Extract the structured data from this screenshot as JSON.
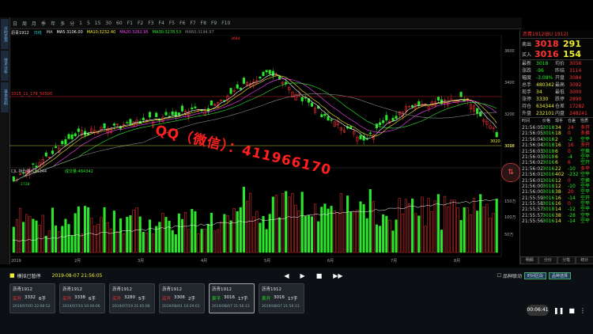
{
  "window": {
    "menu": [
      "日",
      "周",
      "月",
      "季",
      "年",
      "多",
      "分",
      "1",
      "5",
      "15",
      "30",
      "60",
      "F1",
      "F2",
      "F3",
      "F4",
      "F5",
      "F6",
      "F7",
      "F8",
      "F9",
      "F10"
    ]
  },
  "left_tools": [
    "分时走势",
    "技术分析",
    "基本资料"
  ],
  "instrument": {
    "name": "沥青1912",
    "period": "日线"
  },
  "ma_legend": [
    {
      "label": "MA",
      "color": "#cccccc"
    },
    {
      "label": "MA5:3106.00",
      "color": "#ffffff"
    },
    {
      "label": "MA10:3232.40",
      "color": "#ffee33"
    },
    {
      "label": "MA20:3262.95",
      "color": "#ff44ff"
    },
    {
      "label": "MA30:3278.53",
      "color": "#33ee33"
    },
    {
      "label": "MA60:3194.97",
      "color": "#888888"
    }
  ],
  "chart_annotations": {
    "high_label": "3684",
    "low_label": "2728",
    "line_label": "3315_11_179_50500",
    "price_tags": [
      "3020",
      "3018"
    ],
    "y_ticks": [
      "3600",
      "3400",
      "3200",
      "3000"
    ]
  },
  "volume_legend": {
    "oi": "CJL",
    "oi_value": "持仓量:634344",
    "vol": "成交量:484342"
  },
  "volume_axis": [
    "150万",
    "100万",
    "50万"
  ],
  "x_axis": [
    "2019",
    "2月",
    "3月",
    "4月",
    "5月",
    "6月",
    "7月",
    "8月"
  ],
  "watermark": "QQ（微信）：411966170",
  "quote_panel": {
    "title": "沥青1912(BU 1912)",
    "sell": {
      "label": "卖出",
      "price": "3018",
      "qty": "291"
    },
    "buy": {
      "label": "买入",
      "price": "3016",
      "qty": "154"
    },
    "rows": [
      {
        "k": "最新",
        "v": "3018",
        "k2": "均价",
        "v2": "3056"
      },
      {
        "k": "涨跌",
        "v": "-96",
        "k2": "昨结",
        "v2": "3114"
      },
      {
        "k": "幅度",
        "v": "-3.08%",
        "k2": "开盘",
        "v2": "3084"
      },
      {
        "k": "总手",
        "v": "480342",
        "k2": "最高",
        "v2": "3092"
      },
      {
        "k": "现手",
        "v": "34",
        "k2": "最低",
        "v2": "3000"
      },
      {
        "k": "涨停",
        "v": "3330",
        "k2": "跌停",
        "v2": "2890"
      },
      {
        "k": "持仓",
        "v": "634344",
        "k2": "仓差",
        "v2": "17282"
      },
      {
        "k": "外盘",
        "v": "232101",
        "k2": "内盘",
        "v2": "248241"
      }
    ],
    "tick_header": [
      "时间",
      "价格",
      "现手",
      "仓差",
      "性质"
    ],
    "ticks": [
      [
        "21:56:05",
        "3018",
        "34",
        "24",
        "多开"
      ],
      [
        "21:56:05",
        "3016",
        "18",
        "0",
        "多换"
      ],
      [
        "21:56:04",
        "3018",
        "2",
        "-2",
        "空平"
      ],
      [
        "21:56:04",
        "3018",
        "16",
        "16",
        "多开"
      ],
      [
        "21:56:03",
        "3018",
        "6",
        "0",
        "空换"
      ],
      [
        "21:56:03",
        "3018",
        "6",
        "-4",
        "空平"
      ],
      [
        "21:56:02",
        "3016",
        "6",
        "6",
        "空开"
      ],
      [
        "21:56:02",
        "3016",
        "22",
        "-10",
        "多平"
      ],
      [
        "21:56:01",
        "3016",
        "402",
        "-232",
        "空平"
      ],
      [
        "21:56:01",
        "3016",
        "12",
        "0",
        "空换"
      ],
      [
        "21:56:00",
        "3018",
        "12",
        "-10",
        "空平"
      ],
      [
        "21:56:00",
        "3018",
        "38",
        "20",
        "空平"
      ],
      [
        "21:55:59",
        "3016",
        "16",
        "-14",
        "空开"
      ],
      [
        "21:55:58",
        "3016",
        "16",
        "0",
        "空平"
      ],
      [
        "21:55:57",
        "3018",
        "14",
        "-12",
        "空平"
      ],
      [
        "21:55:57",
        "3016",
        "38",
        "-28",
        "空平"
      ],
      [
        "21:55:56",
        "3016",
        "14",
        "-14",
        "空平"
      ]
    ],
    "tabs": [
      "明细",
      "分价",
      "分笔",
      "统计"
    ]
  },
  "replay": {
    "label": "模拟已暂停",
    "time": "2019-08-07 21:56:05",
    "mode_label": "品种联动",
    "btn1": "时间区段",
    "btn2": "品种选择",
    "timer": "00:06:41"
  },
  "trade_cards": [
    {
      "name": "沥青1912",
      "action": "买开",
      "price": "3332",
      "qty": "6手",
      "date": "2019/07/05 22:06:52"
    },
    {
      "name": "沥青1912",
      "action": "买开",
      "price": "3338",
      "qty": "6手",
      "date": "2019/07/16 10:06:06"
    },
    {
      "name": "沥青1912",
      "action": "买开",
      "price": "3280",
      "qty": "5手",
      "date": "2019/07/19 21:05:06"
    },
    {
      "name": "沥青1912",
      "action": "买开",
      "price": "3306",
      "qty": "2手",
      "date": "2019/08/01 10:29:01"
    },
    {
      "name": "沥青1912",
      "action": "卖平",
      "price": "3016",
      "qty": "17手",
      "date": "2019/08/07 21:56:13"
    },
    {
      "name": "沥青1912",
      "action": "卖开",
      "price": "3016",
      "qty": "17手",
      "date": "2019/08/07 21:56:13"
    }
  ]
}
